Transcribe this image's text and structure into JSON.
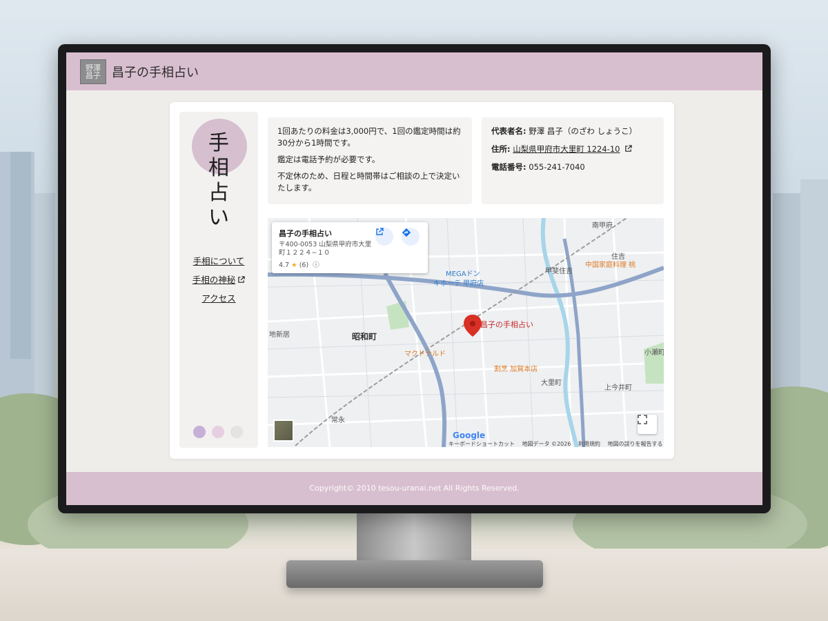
{
  "site": {
    "logo_text": "野澤\n昌子",
    "title": "昌子の手相占い"
  },
  "sidebar": {
    "vertical_title": [
      "手",
      "相",
      "占",
      "い"
    ],
    "nav": [
      {
        "label": "手相について",
        "external": false
      },
      {
        "label": "手相の神秘",
        "external": true
      },
      {
        "label": "アクセス",
        "external": false
      }
    ],
    "dot_colors": [
      "#c6b0d8",
      "#e6cfe1",
      "#e3e3e3"
    ],
    "accent_circle_color": "#d6bfcf"
  },
  "info": {
    "fee_text": "1回あたりの料金は3,000円で、1回の鑑定時間は約30分から1時間です。",
    "reservation_text": "鑑定は電話予約が必要です。",
    "schedule_text": "不定休のため、日程と時間帯はご相談の上で決定いたします。"
  },
  "contact": {
    "rep_label": "代表者名:",
    "rep_value": "野澤 昌子（のざわ しょうこ）",
    "address_label": "住所:",
    "address_value": "山梨県甲府市大里町 1224-10",
    "phone_label": "電話番号:",
    "phone_value": "055-241-7040"
  },
  "map": {
    "popup": {
      "title": "昌子の手相占い",
      "address": "〒400-0053 山梨県甲府市大里町１２２４−１０",
      "rating": "4.7",
      "reviews": "(6)"
    },
    "labels": {
      "pin": "昌子の手相占い",
      "area_showa": "昭和町",
      "mcdonalds": "マクドナルド",
      "mega": "MEGAドン",
      "mega2": "キホーテ 甲府店",
      "kaga": "割烹 加賀本店",
      "chinese": "中国家庭料理 桃",
      "sumiyoshi": "甲斐住吉",
      "sumiyoshi2": "住吉",
      "minamikoshi": "南甲府",
      "chishinbo": "地新居",
      "jouei": "常永",
      "osato": "大里町",
      "kamiimai": "上今井町",
      "kosegawa": "小瀬町"
    },
    "footer": [
      "キーボードショートカット",
      "地図データ ©2026",
      "利用規約",
      "地図の誤りを報告する"
    ],
    "google": "Google"
  },
  "footer": {
    "copyright": "Copyright© 2010 tesou-uranai.net All Rights Reserved."
  }
}
